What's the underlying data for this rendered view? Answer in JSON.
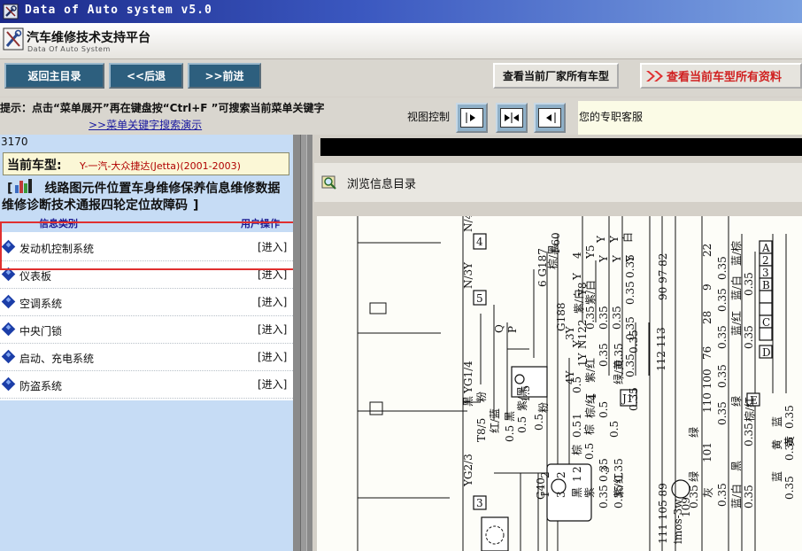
{
  "window": {
    "title": "Data of Auto system v5.0",
    "header_title": "汽车维修技术支持平台",
    "header_subtitle": "Data Of Auto System"
  },
  "toolbar": {
    "home": "返回主目录",
    "back": "<<后退",
    "forward": ">>前进",
    "all_models": "查看当前厂家所有车型",
    "all_data": "查看当前车型所有资料"
  },
  "hint": {
    "text": "提示：点击“菜单展开”再在键盘按“Ctrl+F ”可搜索当前菜单关键字",
    "demo_link": ">>菜单关键字搜索演示",
    "view_control": "视图控制",
    "support": "您的专职客服"
  },
  "sidebar": {
    "code": "3170",
    "model_label": "当前车型:",
    "model_value": "Y-一汽-大众捷达(Jetta)(2001-2003)",
    "categories_text": "线路图元件位置车身维修保养信息维修数据维修诊断技术通报四轮定位故障码",
    "col_type": "信息类别",
    "col_action": "用户操作",
    "items": [
      {
        "label": "发动机控制系统",
        "action": "[进入]"
      },
      {
        "label": "仪表板",
        "action": "[进入]"
      },
      {
        "label": "空调系统",
        "action": "[进入]"
      },
      {
        "label": "中央门锁",
        "action": "[进入]"
      },
      {
        "label": "启动、充电系统",
        "action": "[进入]"
      },
      {
        "label": "防盗系统",
        "action": "[进入]"
      }
    ]
  },
  "content": {
    "browse_label": "浏览信息目录"
  },
  "diagram": {
    "t1": "N/4",
    "t2": "4",
    "t3": "Y",
    "t4": "N/3",
    "t5": "5",
    "t6": "YG1/4",
    "t7": "黑",
    "t8": "粉",
    "t9": "T8/5",
    "t10": "红/蓝",
    "t11": "YG2/3",
    "t12": "3",
    "t13": "G40",
    "t14": "6 G187",
    "t15": "G188",
    "t16": "N122",
    "t17": "Q",
    "t18": "P",
    "t19": "1.5",
    "t20": "0.5",
    "t21": "J1",
    "t22": "0.35",
    "t23": "0.35",
    "t24": "0.35",
    "t25": "111 105 89",
    "t26": "112 113",
    "t27": "90 97 82",
    "t28": "110 100",
    "t29": "76",
    "t30": "28",
    "t31": "9",
    "t32": "22",
    "t33": "101",
    "t34": "109",
    "t35": "绿",
    "t36": "蓝/红",
    "t37": "蓝/白",
    "t38": "蓝/棕",
    "t39": "A",
    "t40": "B",
    "t41": "C",
    "t42": "D",
    "t43": "E",
    "t44": "2",
    "t45": "3",
    "t46": "棕/红",
    "t47": "黄",
    "t48": "蓝",
    "t49": "灰",
    "t50": "黑",
    "t51": "绿",
    "t52": "imos-3w",
    "t53": "紫/白",
    "t54": "紫/红",
    "t55": "棕/红",
    "t56": "棕/黑",
    "t57": "Y",
    "t58": "Y",
    "t59": "白",
    "t60": "0.35",
    "t61": "0.35",
    "t62": "0.35",
    "t63": "0.35",
    "t64": "0.35",
    "t65": "0.35",
    "t66": "0.35",
    "t67": "0.35",
    "t68": "0.35",
    "t69": "0.35",
    "t70": "0.35",
    "t71": "0.35",
    "t72": "0.35",
    "t73": "0.35",
    "t74": "0.35",
    "t75": "0.35",
    "t76": "0.35",
    "t77": "2",
    "t78": "3",
    "t79": "4",
    "t80": "1",
    "t81": "紫",
    "t82": "黑",
    "t83": "粉",
    "t84": "紫/红",
    "t85": "0.5",
    "t86": "0.5",
    "t87": "Y",
    "t88": "Y",
    "t89": "蓝",
    "t90": "棕",
    "t91": "0.35",
    "t92": "0.35",
    "t93": "0.35",
    "t94": "0.35",
    "t95": "0.5",
    "t96": "紫/白",
    "t97": "0.35",
    "t98": "绿/黄",
    "t99": "蓝/白",
    "t100": "0.35",
    "t101": "0.35",
    "t102": "黑",
    "t103": "紫/黑",
    "t104": "0.5",
    "t105": "0.5",
    "t106": "0.5",
    "t107": "棕",
    "t108": "0.5",
    "t109": "F60",
    "t110": "4",
    "t111": "Y5",
    "t112": "Y",
    "t113": "Y",
    "t114": "Y",
    "t115": "Y8",
    "t116": "1Y",
    "t117": "4Y",
    "t118": "3Y",
    "t119": "2",
    "t120": "1",
    "t121": "3",
    "t122": "2",
    "t123": "1",
    "t124": "黄",
    "t125": "0.35",
    "t126": "绿",
    "t127": "0.35"
  },
  "colors": {
    "titlebar_start": "#1c2a8a",
    "titlebar_end": "#7aa0e0",
    "toolbar_btn": "#2d5f7e",
    "red_accent": "#e03030",
    "sidebar_bg": "#c6dcf5",
    "model_value": "#b00000",
    "highlight_box": "#e03030"
  }
}
